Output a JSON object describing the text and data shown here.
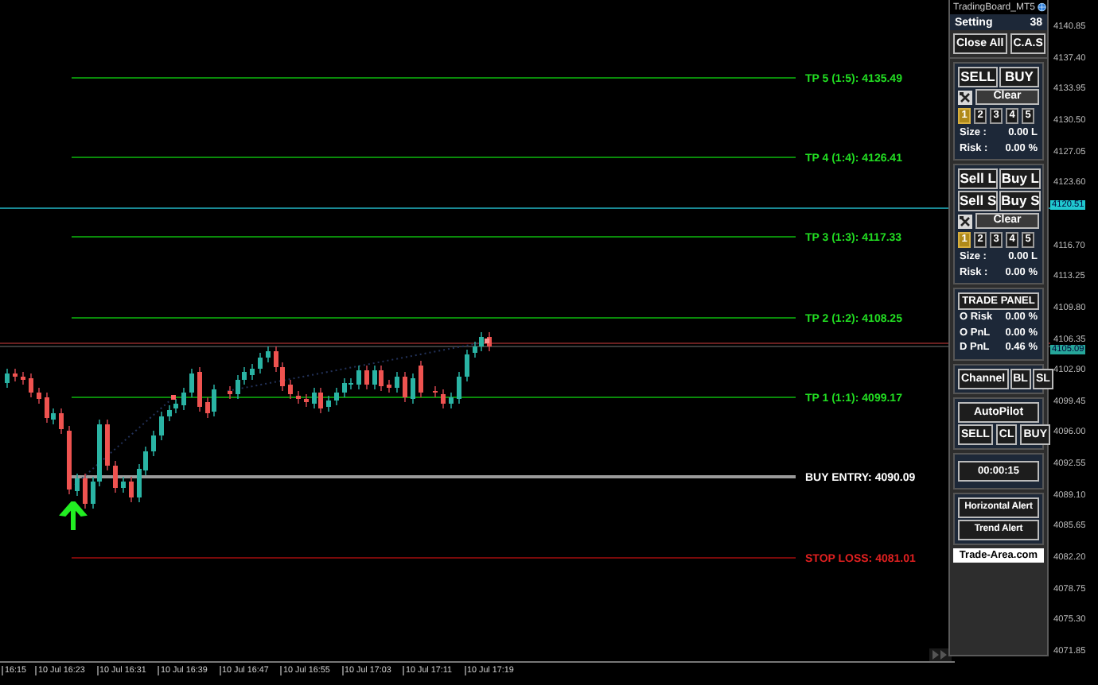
{
  "levels": [
    {
      "label": "TP 5 (1:5): 4135.49",
      "kind": "tp"
    },
    {
      "label": "TP 4 (1:4): 4126.41",
      "kind": "tp"
    },
    {
      "label": "TP 3 (1:3): 4117.33",
      "kind": "tp"
    },
    {
      "label": "TP 2 (1:2): 4108.25",
      "kind": "tp"
    },
    {
      "label": "TP 1 (1:1): 4099.17",
      "kind": "tp"
    },
    {
      "label": "BUY ENTRY: 4090.09",
      "kind": "entry"
    },
    {
      "label": "STOP LOSS: 4081.01",
      "kind": "sl"
    }
  ],
  "price_axis": [
    "4140.85",
    "4137.40",
    "4133.95",
    "4130.50",
    "4127.05",
    "4123.60",
    "4116.70",
    "4113.25",
    "4109.80",
    "4106.35",
    "4102.90",
    "4099.45",
    "4096.00",
    "4092.55",
    "4089.10",
    "4085.65",
    "4082.20",
    "4078.75",
    "4075.30",
    "4071.85"
  ],
  "price_tags": [
    {
      "label": "4120.51",
      "kind": "line"
    },
    {
      "label": "4105.09",
      "kind": "bid"
    }
  ],
  "time_axis": [
    "16:15",
    "10 Jul 16:23",
    "10 Jul 16:31",
    "10 Jul 16:39",
    "10 Jul 16:47",
    "10 Jul 16:55",
    "10 Jul 17:03",
    "10 Jul 17:11",
    "10 Jul 17:19"
  ],
  "panel": {
    "title": "TradingBoard_MT5",
    "setting_label": "Setting",
    "setting_value": "38",
    "top_buttons": [
      "Close All",
      "C.A.S"
    ],
    "market": {
      "buttons": [
        "SELL",
        "BUY"
      ],
      "clear": "Clear",
      "slots": [
        {
          "label": "1",
          "selected": true
        },
        {
          "label": "2",
          "selected": false
        },
        {
          "label": "3",
          "selected": false
        },
        {
          "label": "4",
          "selected": false
        },
        {
          "label": "5",
          "selected": false
        }
      ],
      "rows": [
        {
          "label": "Size :",
          "value": "0.00 L"
        },
        {
          "label": "Risk :",
          "value": "0.00 %"
        }
      ]
    },
    "pending": {
      "buttons": [
        "Sell L",
        "Buy L",
        "Sell S",
        "Buy S"
      ],
      "clear": "Clear",
      "slots": [
        {
          "label": "1",
          "selected": true
        },
        {
          "label": "2",
          "selected": false
        },
        {
          "label": "3",
          "selected": false
        },
        {
          "label": "4",
          "selected": false
        },
        {
          "label": "5",
          "selected": false
        }
      ],
      "rows": [
        {
          "label": "Size :",
          "value": "0.00 L"
        },
        {
          "label": "Risk :",
          "value": "0.00 %"
        }
      ]
    },
    "trade_panel": {
      "title": "TRADE PANEL",
      "rows": [
        {
          "label": "O Risk",
          "value": "0.00 %"
        },
        {
          "label": "O PnL",
          "value": "0.00 %"
        },
        {
          "label": "D PnL",
          "value": "0.46 %"
        }
      ]
    },
    "channel_buttons": [
      "Channel",
      "BL",
      "SL"
    ],
    "autopilot": {
      "title": "AutoPilot",
      "buttons": [
        "SELL",
        "CL",
        "BUY"
      ]
    },
    "timer": "00:00:15",
    "alert_buttons": [
      "Horizontal Alert",
      "Trend Alert"
    ],
    "brand": "Trade-Area.com"
  }
}
